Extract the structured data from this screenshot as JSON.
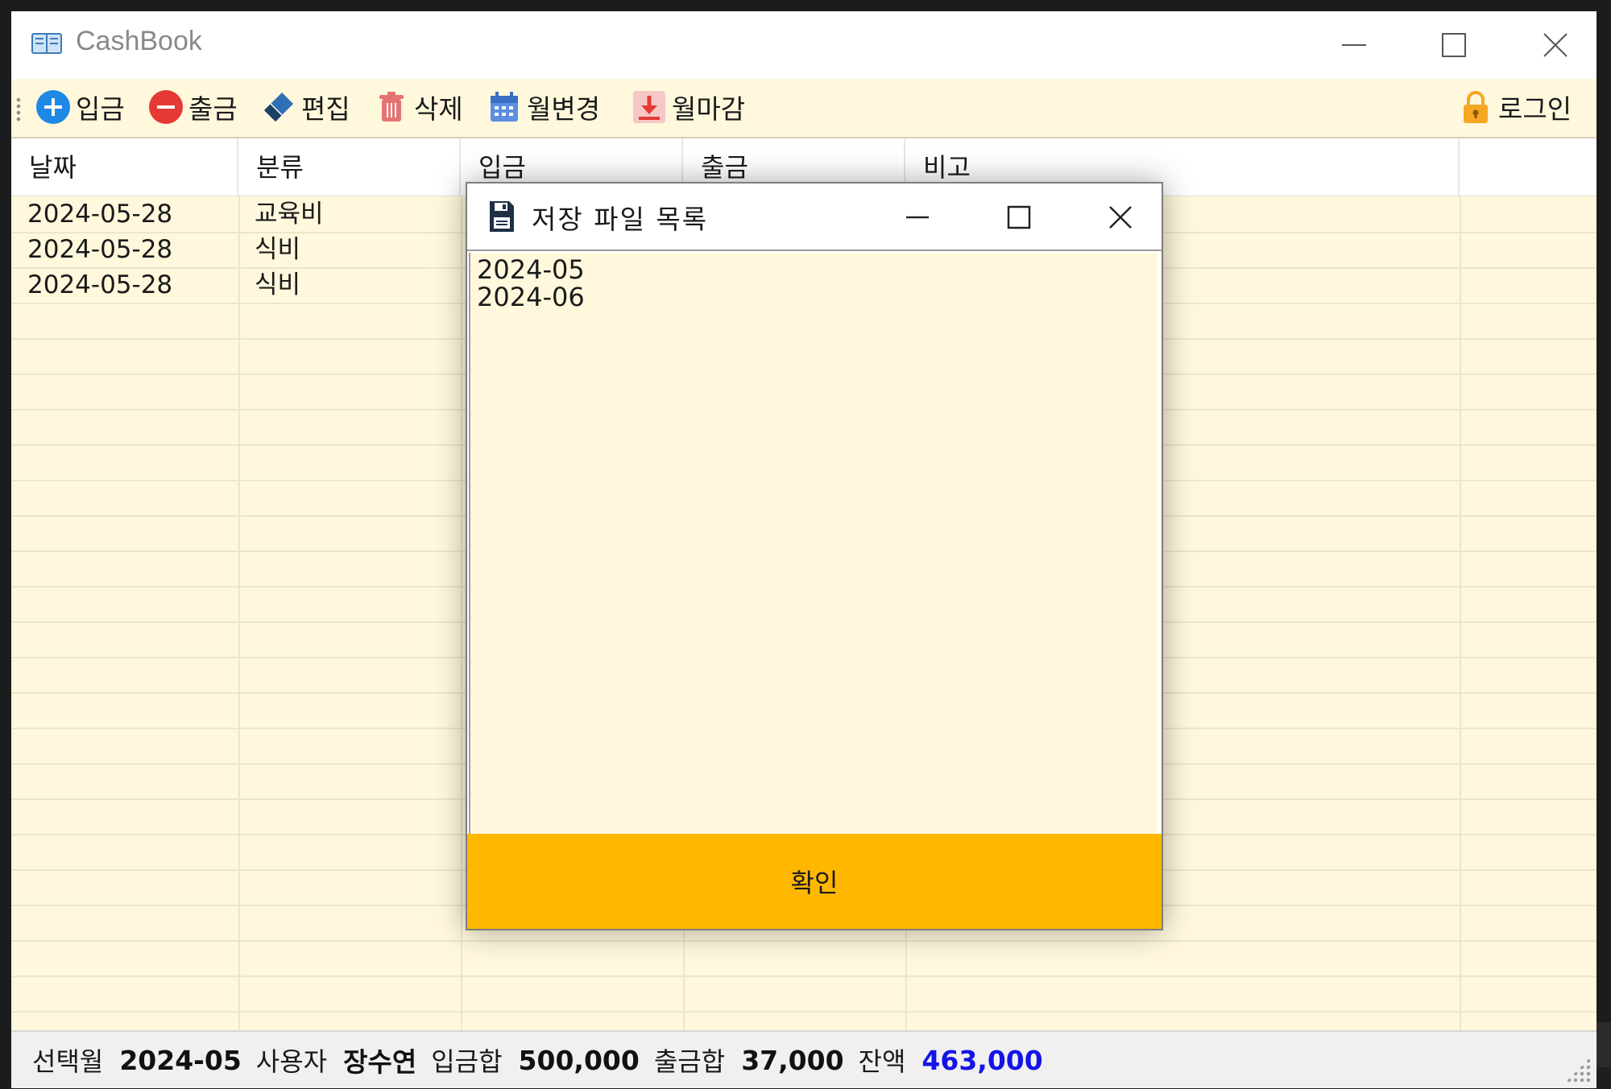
{
  "app": {
    "title": "CashBook"
  },
  "toolbar": {
    "deposit": "입금",
    "withdraw": "출금",
    "edit": "편집",
    "delete": "삭제",
    "change_month": "월변경",
    "month_close": "월마감",
    "login": "로그인"
  },
  "grid": {
    "columns": [
      "날짜",
      "분류",
      "입금",
      "출금",
      "비고",
      ""
    ],
    "rows": [
      {
        "date": "2024-05-28",
        "category": "교육비"
      },
      {
        "date": "2024-05-28",
        "category": "식비"
      },
      {
        "date": "2024-05-28",
        "category": "식비"
      }
    ]
  },
  "status": {
    "month_label": "선택월",
    "month_value": "2024-05",
    "user_label": "사용자",
    "user_value": "장수연",
    "income_label": "입금합",
    "income_value": "500,000",
    "expense_label": "출금합",
    "expense_value": "37,000",
    "balance_label": "잔액",
    "balance_value": "463,000"
  },
  "dialog": {
    "title": "저장 파일 목록",
    "items": [
      "2024-05",
      "2024-06"
    ],
    "ok_label": "확인"
  },
  "colors": {
    "grid_background": "#fff8dc",
    "ok_button": "#ffb700",
    "balance_text": "#1414e6"
  },
  "icons": {
    "app": "book-icon",
    "deposit": "plus-circle-icon",
    "withdraw": "minus-circle-icon",
    "edit": "eraser-icon",
    "delete": "trash-icon",
    "change_month": "calendar-icon",
    "month_close": "download-icon",
    "login": "lock-icon",
    "dialog": "floppy-disk-icon"
  }
}
